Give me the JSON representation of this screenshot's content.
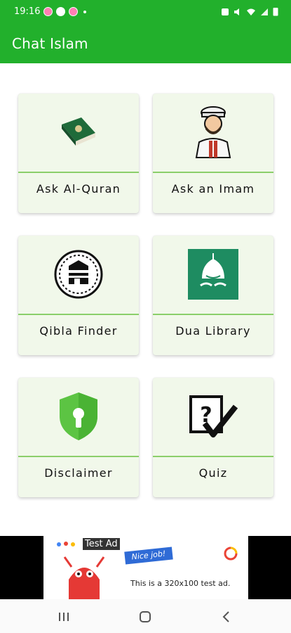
{
  "status": {
    "time": "19:16"
  },
  "app": {
    "title": "Chat Islam"
  },
  "cards": [
    {
      "label": "Ask Al-Quran",
      "icon": "quran-book-icon"
    },
    {
      "label": "Ask an Imam",
      "icon": "imam-icon"
    },
    {
      "label": "Qibla Finder",
      "icon": "kaaba-icon"
    },
    {
      "label": "Dua Library",
      "icon": "dua-mosque-icon"
    },
    {
      "label": "Disclaimer",
      "icon": "shield-lock-icon"
    },
    {
      "label": "Quiz",
      "icon": "quiz-check-icon"
    }
  ],
  "ad": {
    "label": "Test Ad",
    "badge": "Nice job!",
    "text": "This is a 320x100 test ad."
  },
  "colors": {
    "primary": "#22b02c",
    "card_bg": "#f1f8ea",
    "divider": "#8bcf6a"
  }
}
